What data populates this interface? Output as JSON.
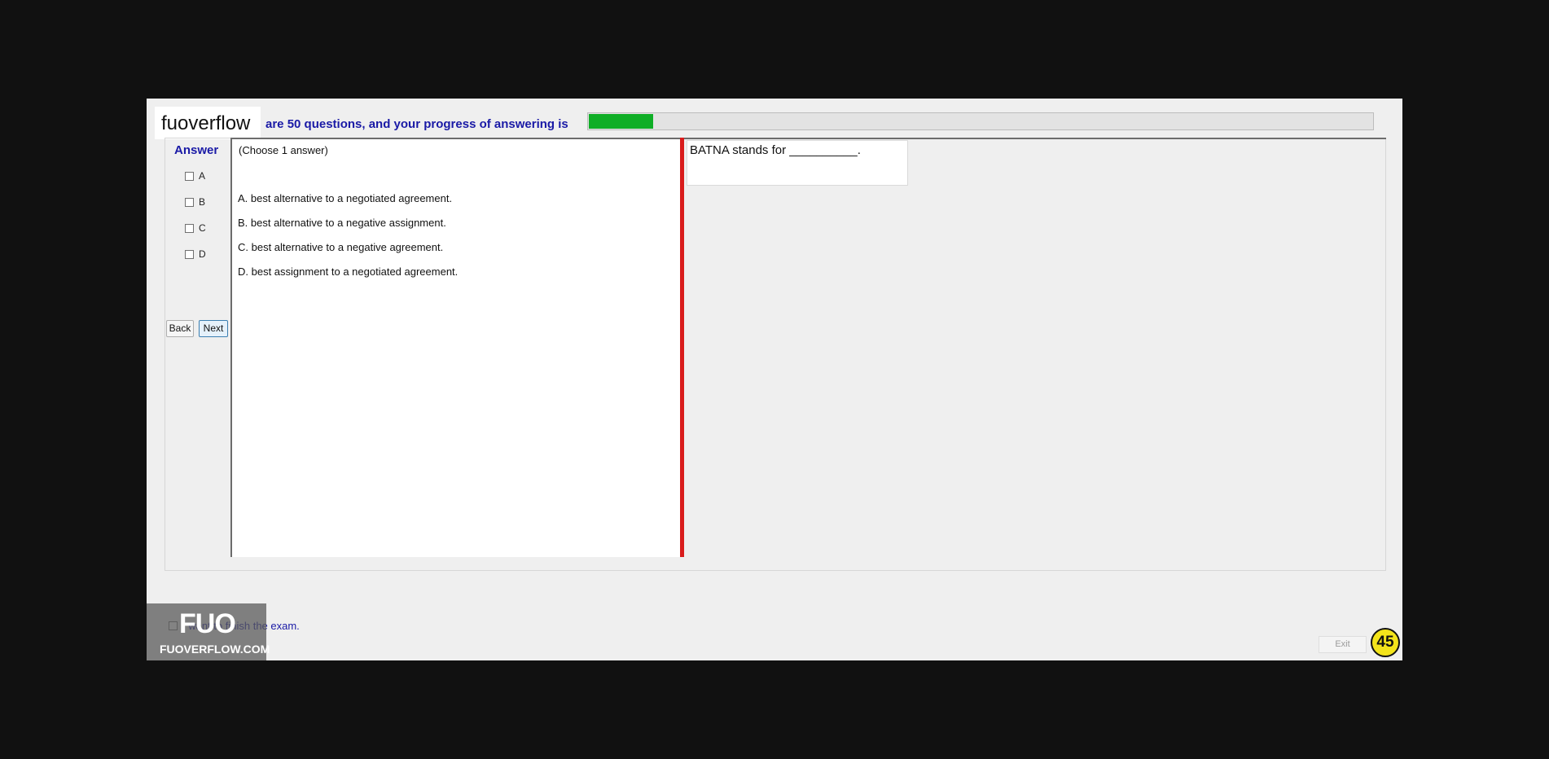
{
  "brand": {
    "name": "fuoverflow"
  },
  "progress": {
    "label": "are 50 questions, and your progress of answering is",
    "fraction": 0.082
  },
  "answer": {
    "heading": "Answer",
    "choices": [
      {
        "label": "A",
        "checked": false
      },
      {
        "label": "B",
        "checked": false
      },
      {
        "label": "C",
        "checked": false
      },
      {
        "label": "D",
        "checked": false
      }
    ]
  },
  "nav": {
    "back_label": "Back",
    "next_label": "Next"
  },
  "options": {
    "instruction": "(Choose 1 answer)",
    "items": [
      "A.  best alternative to a negotiated agreement.",
      "B.  best alternative to a negative assignment.",
      "C.  best alternative to a negative agreement.",
      "D.  best assignment to a negotiated agreement."
    ]
  },
  "question": {
    "text": "BATNA stands for __________."
  },
  "footer": {
    "finish_label": "I want to finish the exam.",
    "exit_label": "Exit",
    "badge": "45",
    "logo_mark": "FUO",
    "logo_text": "FUOVERFLOW.COM"
  },
  "colors": {
    "progress_fill": "#0fae26",
    "divider": "#d91c1c",
    "accent_text": "#1a1aa6",
    "badge": "#f3e41b"
  }
}
